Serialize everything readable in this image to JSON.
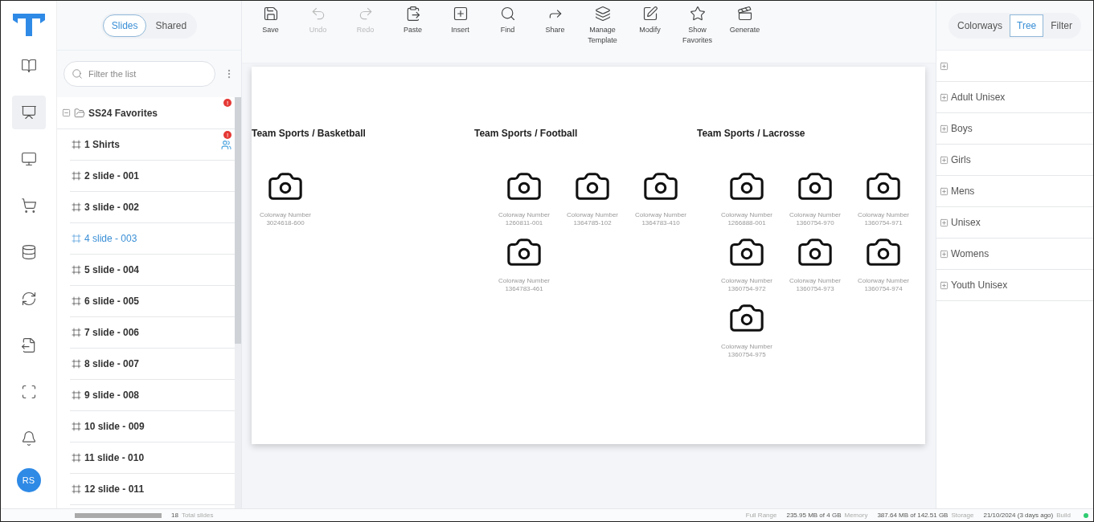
{
  "rail": {
    "items": [
      {
        "kind": "book",
        "selected": false
      },
      {
        "kind": "presentation",
        "selected": true
      },
      {
        "kind": "monitor",
        "selected": false
      },
      {
        "kind": "cart",
        "selected": false
      },
      {
        "kind": "database",
        "selected": false
      },
      {
        "kind": "sync",
        "selected": false
      },
      {
        "kind": "export",
        "selected": false
      },
      {
        "kind": "scan",
        "selected": false
      },
      {
        "kind": "bell",
        "selected": false
      }
    ],
    "avatar": "RS"
  },
  "slides_panel": {
    "tabs": [
      {
        "label": "Slides",
        "selected": true
      },
      {
        "label": "Shared",
        "selected": false
      }
    ],
    "search": {
      "placeholder": "Filter the list"
    },
    "folder": {
      "label": "SS24 Favorites",
      "expanded": true,
      "badge": "!"
    },
    "items": [
      {
        "label": "1 Shirts",
        "selected": false,
        "badge": "!",
        "shared": true
      },
      {
        "label": "2 slide - 001",
        "selected": false,
        "shared": false
      },
      {
        "label": "3 slide - 002",
        "selected": false,
        "shared": false
      },
      {
        "label": "4 slide - 003",
        "selected": true,
        "shared": false
      },
      {
        "label": "5 slide - 004",
        "selected": false,
        "shared": false
      },
      {
        "label": "6 slide - 005",
        "selected": false,
        "shared": false
      },
      {
        "label": "7 slide - 006",
        "selected": false,
        "shared": false
      },
      {
        "label": "8 slide - 007",
        "selected": false,
        "shared": false
      },
      {
        "label": "9 slide - 008",
        "selected": false,
        "shared": false
      },
      {
        "label": "10 slide - 009",
        "selected": false,
        "shared": false
      },
      {
        "label": "11 slide - 010",
        "selected": false,
        "shared": false
      },
      {
        "label": "12 slide - 011",
        "selected": false,
        "shared": false
      }
    ]
  },
  "toolbar": [
    {
      "kind": "save",
      "label": "Save",
      "disabled": false
    },
    {
      "kind": "undo",
      "label": "Undo",
      "disabled": true
    },
    {
      "kind": "redo",
      "label": "Redo",
      "disabled": true
    },
    {
      "kind": "paste",
      "label": "Paste",
      "disabled": false
    },
    {
      "kind": "insert",
      "label": "Insert",
      "disabled": false
    },
    {
      "kind": "find",
      "label": "Find",
      "disabled": false
    },
    {
      "kind": "share",
      "label": "Share",
      "disabled": false
    },
    {
      "kind": "template",
      "label": "Manage Template",
      "disabled": false
    },
    {
      "kind": "modify",
      "label": "Modify",
      "disabled": false
    },
    {
      "kind": "favorites",
      "label": "Show Favorites",
      "disabled": false
    },
    {
      "kind": "generate",
      "label": "Generate",
      "disabled": false
    }
  ],
  "slide": {
    "groups": [
      {
        "title": "Team Sports / Basketball",
        "items": [
          {
            "caption": "Colorway Number",
            "number": "3024618-600"
          }
        ]
      },
      {
        "title": "Team Sports / Football",
        "items": [
          {
            "caption": "Colorway Number",
            "number": "1260811-001"
          },
          {
            "caption": "Colorway Number",
            "number": "1364785-102"
          },
          {
            "caption": "Colorway Number",
            "number": "1364783-410"
          },
          {
            "caption": "Colorway Number",
            "number": "1364783-461"
          }
        ]
      },
      {
        "title": "Team Sports / Lacrosse",
        "items": [
          {
            "caption": "Colorway Number",
            "number": "1266888-001"
          },
          {
            "caption": "Colorway Number",
            "number": "1360754-970"
          },
          {
            "caption": "Colorway Number",
            "number": "1360754-971"
          },
          {
            "caption": "Colorway Number",
            "number": "1360754-972"
          },
          {
            "caption": "Colorway Number",
            "number": "1360754-973"
          },
          {
            "caption": "Colorway Number",
            "number": "1360754-974"
          },
          {
            "caption": "Colorway Number",
            "number": "1360754-975"
          }
        ]
      }
    ]
  },
  "right_panel": {
    "tabs": [
      {
        "label": "Colorways",
        "selected": false
      },
      {
        "label": "Tree",
        "selected": true
      },
      {
        "label": "Filter",
        "selected": false
      }
    ],
    "tree": [
      {
        "expanded": false
      },
      {
        "label": "Adult Unisex",
        "expanded": false
      },
      {
        "label": "Boys",
        "expanded": false
      },
      {
        "label": "Girls",
        "expanded": false
      },
      {
        "label": "Mens",
        "expanded": false
      },
      {
        "label": "Unisex",
        "expanded": false
      },
      {
        "label": "Womens",
        "expanded": false
      },
      {
        "label": "Youth Unisex",
        "expanded": false
      }
    ]
  },
  "status_bar": {
    "count": "18",
    "count_label": "Total slides",
    "range": "Full Range",
    "memory": "235.95 MB of 4 GB",
    "memory_label": "Memory",
    "storage": "387.64 MB of 142.51 GB",
    "storage_label": "Storage",
    "build": "21/10/2024 (3 days ago)",
    "build_label": "Build",
    "online": true
  }
}
